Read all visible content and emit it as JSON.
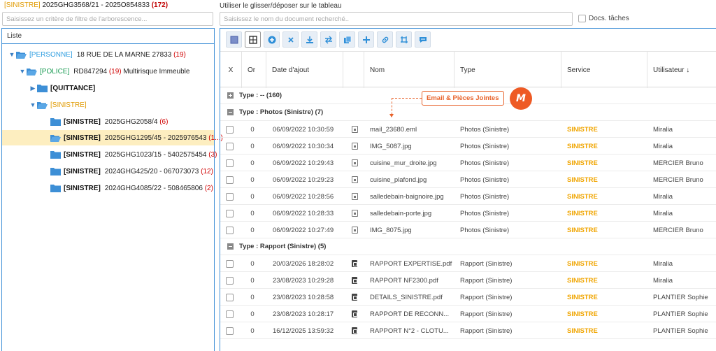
{
  "header": {
    "tag": "[SINISTRE]",
    "ref": "2025GHG3568/21 - 2025O854833",
    "count": "(172)"
  },
  "tree_filter": {
    "placeholder": "Saisissez un critère de filtre de l'arborescence..."
  },
  "tree": {
    "head_label": "Liste",
    "rows": [
      {
        "tag": "[PERSONNE]",
        "ref": "18 RUE DE LA MARNE 27833",
        "count": "(19)"
      },
      {
        "tag": "[POLICE]",
        "ref": "RD847294",
        "count": "(19)",
        "extra": "Multirisque Immeuble"
      },
      {
        "tag": "[QUITTANCE]"
      },
      {
        "tag": "[SINISTRE]"
      },
      {
        "tag": "[SINISTRE]",
        "ref": "2025GHG2058/4",
        "count": "(6)"
      },
      {
        "tag": "[SINISTRE]",
        "ref": "2025GHG1295/45 - 2025976543",
        "count": "(1...)"
      },
      {
        "tag": "[SINISTRE]",
        "ref": "2025GHG1023/15 - 5402575454",
        "count": "(3)"
      },
      {
        "tag": "[SINISTRE]",
        "ref": "2024GHG425/20 - 067073073",
        "count": "(12)"
      },
      {
        "tag": "[SINISTRE]",
        "ref": "2024GHG4085/22 - 508465806",
        "count": "(2)"
      }
    ]
  },
  "right": {
    "dragdrop_label": "Utiliser le glisser/déposer sur le tableau",
    "search_placeholder": "Saisissez le nom du document recherché..",
    "docs_taches_label": "Docs. tâches"
  },
  "toolbar_icons": [
    "view-icon",
    "grid-icon",
    "add-circle-icon",
    "delete-icon",
    "download-icon",
    "transfer-icon",
    "copy-icon",
    "plus-icon",
    "link-icon",
    "crop-icon",
    "message-icon"
  ],
  "columns": {
    "x": "X",
    "o": "Or",
    "date": "Date d'ajout",
    "nom": "Nom",
    "type": "Type",
    "service": "Service",
    "user": "Utilisateur ↓"
  },
  "groups": [
    {
      "label": "Type : -- (160)"
    },
    {
      "label": "Type : Photos (Sinistre) (7)"
    },
    {
      "label": "Type : Rapport (Sinistre) (5)"
    }
  ],
  "photos": [
    {
      "o": "0",
      "date": "06/09/2022 10:30:59",
      "nom": "mail_23680.eml",
      "type": "Photos (Sinistre)",
      "service": "SINISTRE",
      "user": "Miralia"
    },
    {
      "o": "0",
      "date": "06/09/2022 10:30:34",
      "nom": "IMG_5087.jpg",
      "type": "Photos (Sinistre)",
      "service": "SINISTRE",
      "user": "Miralia"
    },
    {
      "o": "0",
      "date": "06/09/2022 10:29:43",
      "nom": "cuisine_mur_droite.jpg",
      "type": "Photos (Sinistre)",
      "service": "SINISTRE",
      "user": "MERCIER Bruno"
    },
    {
      "o": "0",
      "date": "06/09/2022 10:29:23",
      "nom": "cuisine_plafond.jpg",
      "type": "Photos (Sinistre)",
      "service": "SINISTRE",
      "user": "MERCIER Bruno"
    },
    {
      "o": "0",
      "date": "06/09/2022 10:28:56",
      "nom": "salledebain-baignoire.jpg",
      "type": "Photos (Sinistre)",
      "service": "SINISTRE",
      "user": "Miralia"
    },
    {
      "o": "0",
      "date": "06/09/2022 10:28:33",
      "nom": "salledebain-porte.jpg",
      "type": "Photos (Sinistre)",
      "service": "SINISTRE",
      "user": "Miralia"
    },
    {
      "o": "0",
      "date": "06/09/2022 10:27:49",
      "nom": "IMG_8075.jpg",
      "type": "Photos (Sinistre)",
      "service": "SINISTRE",
      "user": "MERCIER Bruno"
    }
  ],
  "rapports": [
    {
      "o": "0",
      "date": "20/03/2026 18:28:02",
      "nom": "RAPPORT EXPERTISE.pdf",
      "type": "Rapport (Sinistre)",
      "service": "SINISTRE",
      "user": "Miralia"
    },
    {
      "o": "0",
      "date": "23/08/2023 10:29:28",
      "nom": "RAPPORT NF2300.pdf",
      "type": "Rapport (Sinistre)",
      "service": "SINISTRE",
      "user": "Miralia"
    },
    {
      "o": "0",
      "date": "23/08/2023 10:28:58",
      "nom": "DETAILS_SINISTRE.pdf",
      "type": "Rapport (Sinistre)",
      "service": "SINISTRE",
      "user": "PLANTIER Sophie"
    },
    {
      "o": "0",
      "date": "23/08/2023 10:28:17",
      "nom": "RAPPORT DE RECONN...",
      "type": "Rapport (Sinistre)",
      "service": "SINISTRE",
      "user": "PLANTIER Sophie"
    },
    {
      "o": "0",
      "date": "16/12/2025 13:59:32",
      "nom": "RAPPORT N°2 - CLOTU...",
      "type": "Rapport (Sinistre)",
      "service": "SINISTRE",
      "user": "PLANTIER Sophie"
    }
  ],
  "callout": {
    "label": "Email & Pièces Jointes"
  },
  "logo": {
    "glyph": "M"
  }
}
